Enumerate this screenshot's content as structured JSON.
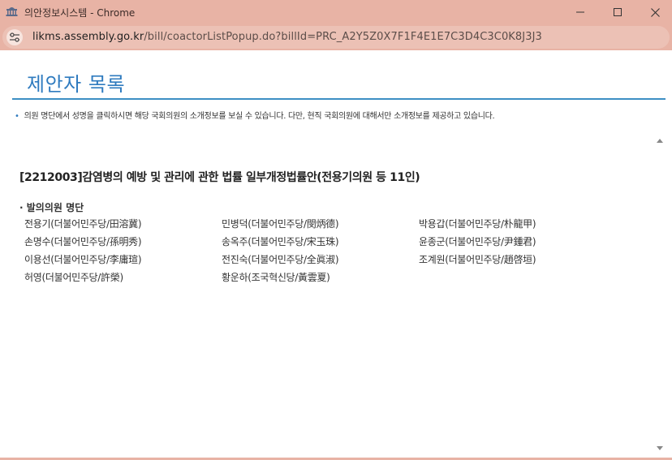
{
  "window": {
    "title": "의안정보시스템 - Chrome",
    "app_icon": "assembly-building-icon",
    "controls": [
      "minimize-icon",
      "maximize-icon",
      "close-icon"
    ]
  },
  "address": {
    "site_icon": "site-settings-icon",
    "domain": "likms.assembly.go.kr",
    "path": "/bill/coactorListPopup.do?billId=PRC_A2Y5Z0X7F1F4E1E7C3D4C3C0K8J3J3"
  },
  "page": {
    "title": "제안자 목록",
    "notice": "의원 명단에서 성명을 클릭하시면 해당 국회의원의 소개정보를 보실 수 있습니다. 다만, 현직 국회의원에 대해서만 소개정보를 제공하고 있습니다.",
    "bill_title": "[2212003]감염병의 예방 및 관리에 관한 법률 일부개정법률안(전용기의원 등 11인)",
    "section_label": "· 발의의원 명단",
    "members": [
      "전용기(더불어민주당/田溶冀)",
      "민병덕(더불어민주당/閔炳德)",
      "박용갑(더불어민주당/朴龍甲)",
      "손명수(더불어민주당/孫明秀)",
      "송옥주(더불어민주당/宋玉珠)",
      "윤종군(더불어민주당/尹鍾君)",
      "이용선(더불어민주당/李庸瑄)",
      "전진숙(더불어민주당/全眞淑)",
      "조계원(더불어민주당/趙啓垣)",
      "허영(더불어민주당/許榮)",
      "황운하(조국혁신당/黃雲夏)"
    ]
  },
  "colors": {
    "titlebar": "#e8b3a5",
    "accent": "#2f7bbf",
    "rule": "#3d8fc4"
  }
}
